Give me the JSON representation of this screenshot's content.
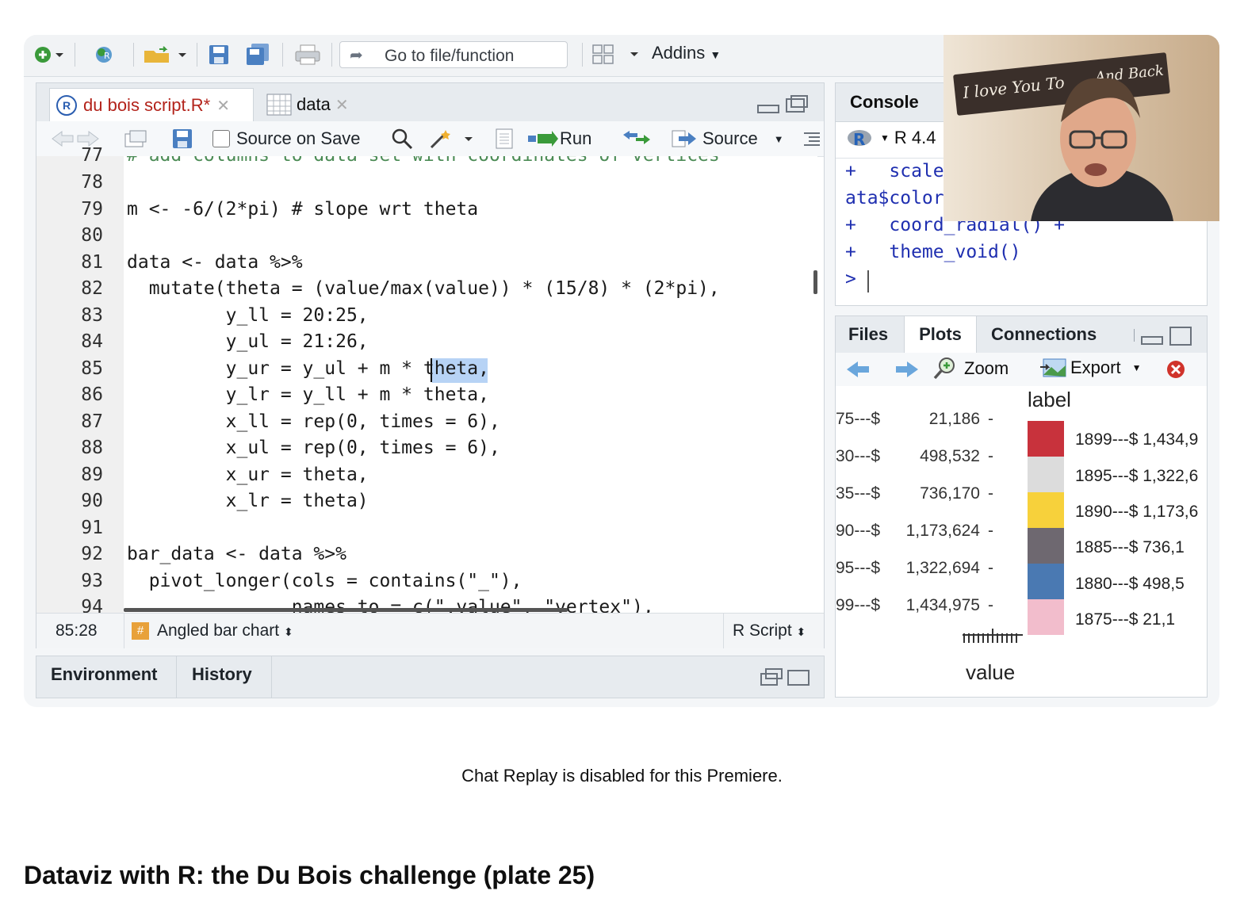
{
  "toolbar": {
    "goto_label": "Go to file/function",
    "addins_label": "Addins"
  },
  "editor": {
    "tabs": [
      {
        "label": "du bois script.R*"
      },
      {
        "label": "data"
      }
    ],
    "toolbar": {
      "source_on_save": "Source on Save",
      "run": "Run",
      "source": "Source"
    },
    "lines": [
      {
        "num": "77",
        "text": "# add columns to data set with coordinates of vertices"
      },
      {
        "num": "78",
        "text": ""
      },
      {
        "num": "79",
        "text": "m <- -6/(2*pi) # slope wrt theta"
      },
      {
        "num": "80",
        "text": ""
      },
      {
        "num": "81",
        "text": "data <- data %>%"
      },
      {
        "num": "82",
        "text": "  mutate(theta = (value/max(value)) * (15/8) * (2*pi),"
      },
      {
        "num": "83",
        "text": "         y_ll = 20:25,"
      },
      {
        "num": "84",
        "text": "         y_ul = 21:26,"
      },
      {
        "num": "85",
        "text": "         y_ur = y_ul + m * theta,"
      },
      {
        "num": "86",
        "text": "         y_lr = y_ll + m * theta,"
      },
      {
        "num": "87",
        "text": "         x_ll = rep(0, times = 6),"
      },
      {
        "num": "88",
        "text": "         x_ul = rep(0, times = 6),"
      },
      {
        "num": "89",
        "text": "         x_ur = theta,"
      },
      {
        "num": "90",
        "text": "         x_lr = theta)"
      },
      {
        "num": "91",
        "text": ""
      },
      {
        "num": "92",
        "text": "bar_data <- data %>%"
      },
      {
        "num": "93",
        "text": "  pivot_longer(cols = contains(\"_\"),"
      },
      {
        "num": "94",
        "text": "               names_to = c(\".value\", \"vertex\"),"
      }
    ],
    "status": {
      "position": "85:28",
      "section": "Angled bar chart",
      "file_type": "R Script"
    }
  },
  "env_pane": {
    "tabs": [
      "Environment",
      "History"
    ]
  },
  "console": {
    "title": "Console",
    "r_version": "R 4.4",
    "lines": [
      "+   scale",
      "ata$color",
      "+   coord_radial() +",
      "+   theme_void()",
      ">"
    ]
  },
  "plots_pane": {
    "tabs": [
      "Files",
      "Plots",
      "Connections"
    ],
    "zoom": "Zoom",
    "export": "Export",
    "axis_labels": [
      {
        "left": "75---$",
        "right": "21,186"
      },
      {
        "left": "30---$",
        "right": "498,532"
      },
      {
        "left": "35---$",
        "right": "736,170"
      },
      {
        "left": "90---$",
        "right": "1,173,624"
      },
      {
        "left": "95---$",
        "right": "1,322,694"
      },
      {
        "left": "99---$",
        "right": "1,434,975"
      }
    ],
    "legend_title": "label",
    "legend": [
      {
        "label": "1899---$ 1,434,9",
        "color": "#c8323c"
      },
      {
        "label": "1895---$ 1,322,6",
        "color": "#dcdcdc"
      },
      {
        "label": "1890---$ 1,173,6",
        "color": "#f7d13b"
      },
      {
        "label": "1885---$    736,1",
        "color": "#6e6870"
      },
      {
        "label": "1880---$    498,5",
        "color": "#4a79b2"
      },
      {
        "label": "1875---$      21,1",
        "color": "#f2bdcc"
      }
    ],
    "x_title": "value"
  },
  "webcam": {
    "sign_left": "I love You To",
    "sign_right": "And Back"
  },
  "page": {
    "chat_message": "Chat Replay is disabled for this Premiere.",
    "video_title": "Dataviz with R: the Du Bois challenge (plate 25)"
  }
}
